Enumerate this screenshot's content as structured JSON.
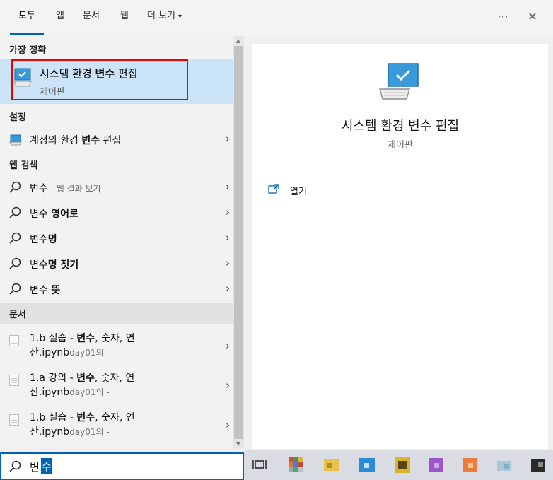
{
  "tabs": {
    "all": "모두",
    "apps": "앱",
    "documents": "문서",
    "web": "웹",
    "more": "더 보기"
  },
  "top_icons": {
    "options": "···",
    "close": "✕"
  },
  "sections": {
    "best_match": "가장 정확",
    "settings": "설정",
    "web_search": "웹 검색",
    "documents": "문서"
  },
  "best_match": {
    "title_pre": "시스템 환경 ",
    "title_bold": "변수",
    "title_post": " 편집",
    "subtitle": "제어판"
  },
  "settings_item": {
    "pre": "계정의 환경 ",
    "bold": "변수",
    "post": " 편집"
  },
  "web_items": [
    {
      "text": "변수",
      "suffix": " - 웹 결과 보기",
      "bold": false
    },
    {
      "pre": "변수 ",
      "bold_part": "영어로"
    },
    {
      "pre": "변수",
      "bold_part": "명"
    },
    {
      "pre": "변수",
      "bold_part": "명 짓기"
    },
    {
      "pre": "변수 ",
      "bold_part": "뜻"
    }
  ],
  "doc_items": [
    {
      "pre": "1.b 실습 - ",
      "bold": "변수",
      "post": ", 숫자, 연",
      "line2": "산.ipynb",
      "meta": "day01의 -"
    },
    {
      "pre": "1.a 강의 - ",
      "bold": "변수",
      "post": ", 숫자, 연",
      "line2": "산.ipynb",
      "meta": "day01의 -"
    },
    {
      "pre": "1.b 실습 - ",
      "bold": "변수",
      "post": ", 숫자, 연",
      "line2": "산.ipynb",
      "meta": "day01의 -"
    }
  ],
  "detail": {
    "title": "시스템 환경 변수 편집",
    "subtitle": "제어판",
    "open_label": "열기"
  },
  "search": {
    "typed": "변",
    "selected": "수"
  },
  "colors": {
    "accent": "#0063b1",
    "selection_bg": "#cce4f7",
    "highlight_box": "#e00000"
  },
  "icons": {
    "chevron": "›",
    "caret": "▾"
  }
}
